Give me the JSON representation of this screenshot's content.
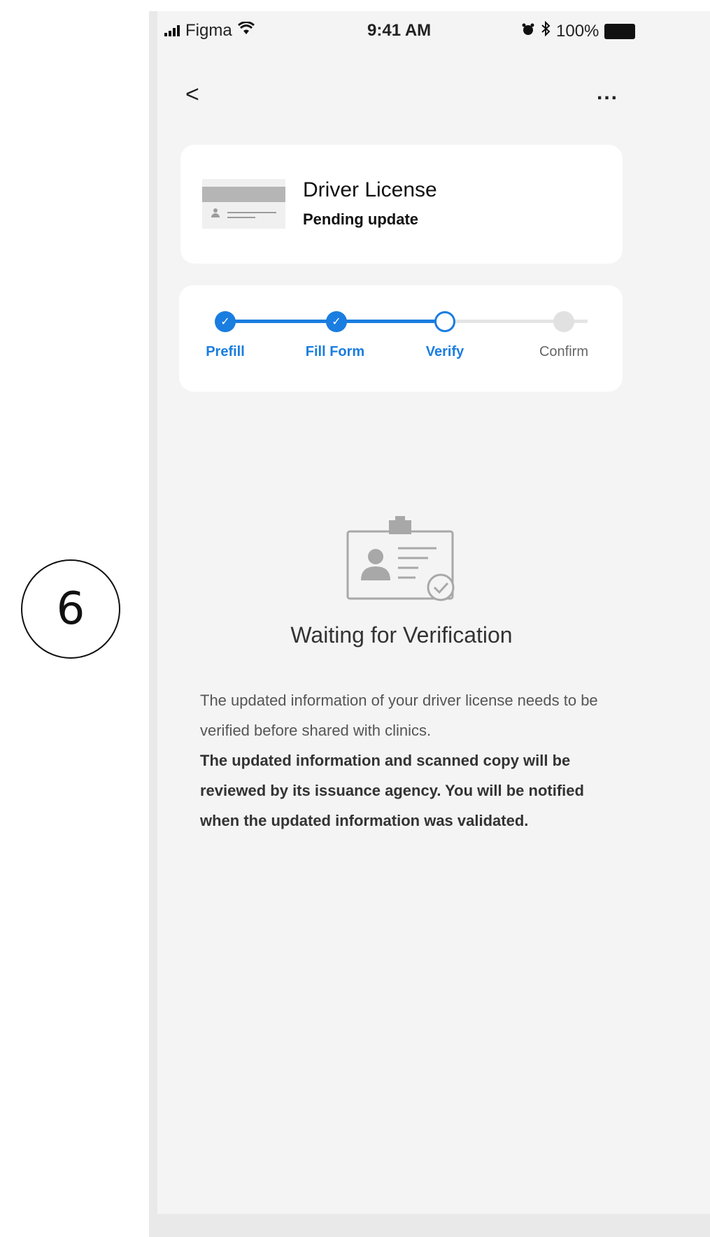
{
  "step_number": "6",
  "status_bar": {
    "carrier": "Figma",
    "time": "9:41 AM",
    "battery": "100%"
  },
  "nav": {
    "back_glyph": "<",
    "more_glyph": "..."
  },
  "document": {
    "title": "Driver License",
    "status": "Pending update"
  },
  "progress": {
    "steps": [
      {
        "label": "Prefill",
        "state": "done"
      },
      {
        "label": "Fill Form",
        "state": "done"
      },
      {
        "label": "Verify",
        "state": "current"
      },
      {
        "label": "Confirm",
        "state": "todo"
      }
    ],
    "accent_color": "#1a7de0"
  },
  "verification": {
    "title": "Waiting for Verification",
    "description": "The updated information of your driver license needs to be verified before shared with clinics.",
    "description_bold": "The updated information and scanned copy will be reviewed by its issuance agency. You will be notified when the updated information was validated."
  }
}
